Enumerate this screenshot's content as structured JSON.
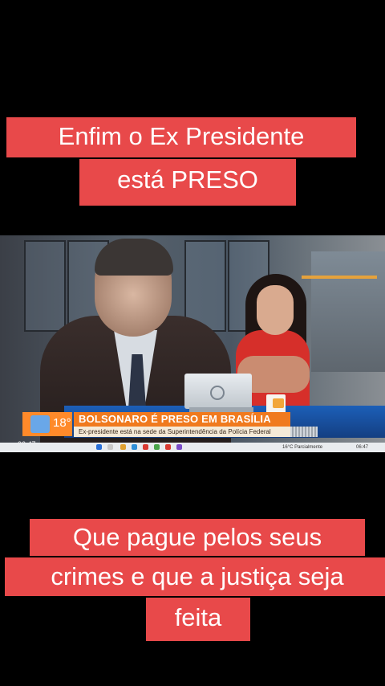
{
  "captions": {
    "top_line1": "Enfim o Ex Presidente",
    "top_line2": "está PRESO",
    "bottom_line1": "Que pague pelos seus",
    "bottom_line2": "crimes e que a justiça seja",
    "bottom_line3": "feita",
    "caption_bg_color": "#e8494a",
    "caption_text_color": "#ffffff"
  },
  "broadcast": {
    "logo_number": "18°",
    "headline": "BOLSONARO É PRESO EM BRASÍLIA",
    "subheadline": "Ex-presidente está na sede da Superintendência da Polícia Federal",
    "clock": "06:47",
    "headline_bar_color": "#f07a1e",
    "desk_color": "#1c5fb8"
  },
  "taskbar": {
    "weather": "16°C Parcialmente",
    "time": "06:47"
  }
}
